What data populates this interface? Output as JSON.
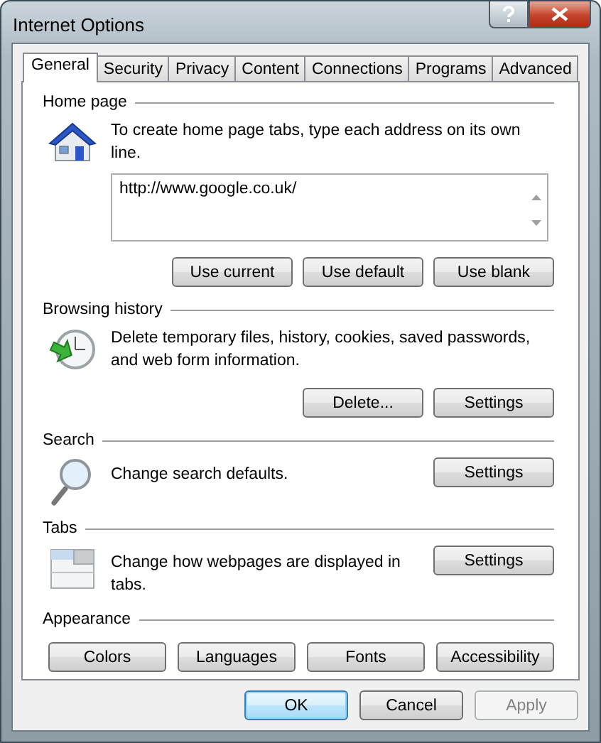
{
  "window": {
    "title": "Internet Options"
  },
  "tabs": [
    {
      "label": "General",
      "selected": true
    },
    {
      "label": "Security",
      "selected": false
    },
    {
      "label": "Privacy",
      "selected": false
    },
    {
      "label": "Content",
      "selected": false
    },
    {
      "label": "Connections",
      "selected": false
    },
    {
      "label": "Programs",
      "selected": false
    },
    {
      "label": "Advanced",
      "selected": false
    }
  ],
  "sections": [
    {
      "kind": "home",
      "heading": "Home page",
      "description": "To create home page tabs, type each address on its own line.",
      "field": {
        "value": "http://www.google.co.uk/"
      },
      "buttons": [
        {
          "label": "Use current",
          "disabled": false
        },
        {
          "label": "Use default",
          "disabled": false
        },
        {
          "label": "Use blank",
          "disabled": false
        }
      ]
    },
    {
      "kind": "history",
      "heading": "Browsing history",
      "description": "Delete temporary files, history, cookies, saved passwords, and web form information.",
      "buttons": [
        {
          "label": "Delete...",
          "disabled": false
        },
        {
          "label": "Settings",
          "disabled": false
        }
      ]
    },
    {
      "kind": "search",
      "heading": "Search",
      "description": "Change search defaults.",
      "buttons": [
        {
          "label": "Settings",
          "disabled": false
        }
      ]
    },
    {
      "kind": "tabs",
      "heading": "Tabs",
      "description": "Change how webpages are displayed in tabs.",
      "buttons": [
        {
          "label": "Settings",
          "disabled": false
        }
      ]
    },
    {
      "kind": "appearance",
      "heading": "Appearance",
      "buttons": [
        {
          "label": "Colors",
          "disabled": false
        },
        {
          "label": "Languages",
          "disabled": false
        },
        {
          "label": "Fonts",
          "disabled": false
        },
        {
          "label": "Accessibility",
          "disabled": false
        }
      ]
    }
  ],
  "dialog_buttons": [
    {
      "label": "OK",
      "default": true,
      "disabled": false
    },
    {
      "label": "Cancel",
      "default": false,
      "disabled": false
    },
    {
      "label": "Apply",
      "default": false,
      "disabled": true
    }
  ]
}
